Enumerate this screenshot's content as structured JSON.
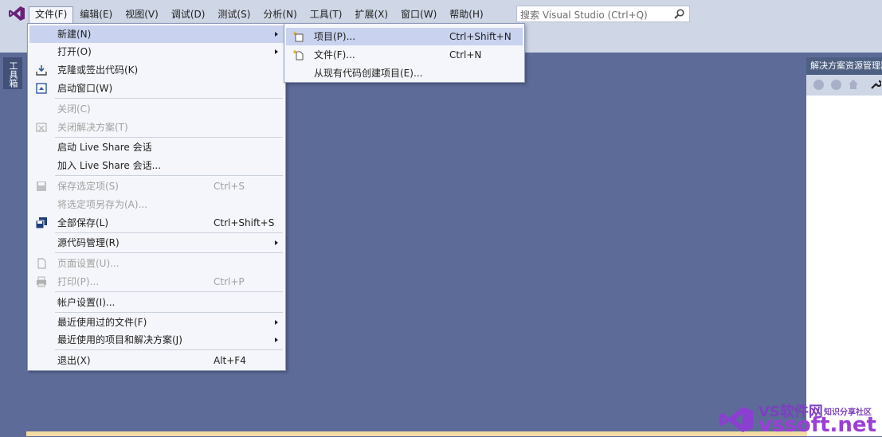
{
  "menubar": [
    {
      "label": "文件(F)",
      "open": true
    },
    {
      "label": "编辑(E)"
    },
    {
      "label": "视图(V)"
    },
    {
      "label": "调试(D)"
    },
    {
      "label": "测试(S)"
    },
    {
      "label": "分析(N)"
    },
    {
      "label": "工具(T)"
    },
    {
      "label": "扩展(X)"
    },
    {
      "label": "窗口(W)"
    },
    {
      "label": "帮助(H)"
    }
  ],
  "search": {
    "placeholder": "搜索 Visual Studio (Ctrl+Q)"
  },
  "toolbox_tab": "工具箱",
  "solution_explorer": {
    "title": "解决方案资源管理器"
  },
  "file_menu": {
    "items": [
      {
        "label": "新建(N)",
        "submenu": true,
        "highlighted": true
      },
      {
        "label": "打开(O)",
        "submenu": true
      },
      {
        "label": "克隆或签出代码(K)",
        "icon": "clone-icon"
      },
      {
        "label": "启动窗口(W)",
        "icon": "start-window-icon"
      },
      {
        "label": "关闭(C)",
        "disabled": true
      },
      {
        "label": "关闭解决方案(T)",
        "disabled": true,
        "icon": "close-solution-icon"
      },
      {
        "label": "启动 Live Share 会话"
      },
      {
        "label": "加入 Live Share 会话..."
      },
      {
        "label": "保存选定项(S)",
        "disabled": true,
        "shortcut": "Ctrl+S",
        "icon": "save-icon"
      },
      {
        "label": "将选定项另存为(A)...",
        "disabled": true
      },
      {
        "label": "全部保存(L)",
        "shortcut": "Ctrl+Shift+S",
        "icon": "save-all-icon"
      },
      {
        "label": "源代码管理(R)",
        "submenu": true
      },
      {
        "label": "页面设置(U)...",
        "disabled": true,
        "icon": "page-setup-icon"
      },
      {
        "label": "打印(P)...",
        "disabled": true,
        "shortcut": "Ctrl+P",
        "icon": "print-icon"
      },
      {
        "label": "帐户设置(I)..."
      },
      {
        "label": "最近使用过的文件(F)",
        "submenu": true
      },
      {
        "label": "最近使用的项目和解决方案(J)",
        "submenu": true
      },
      {
        "label": "退出(X)",
        "shortcut": "Alt+F4"
      }
    ]
  },
  "new_submenu": {
    "items": [
      {
        "label": "项目(P)...",
        "shortcut": "Ctrl+Shift+N",
        "icon": "new-project-icon",
        "highlighted": true
      },
      {
        "label": "文件(F)...",
        "shortcut": "Ctrl+N",
        "icon": "new-file-icon"
      },
      {
        "label": "从现有代码创建项目(E)..."
      }
    ]
  },
  "watermark": {
    "brand": "VS软件网",
    "tagline": "知识分享社区",
    "domain": "vssoft.net"
  },
  "colors": {
    "accent_purple": "#68217a",
    "menu_highlight": "#c9d3ef",
    "workspace": "#5d6b99",
    "chrome": "#cfd6e5"
  }
}
